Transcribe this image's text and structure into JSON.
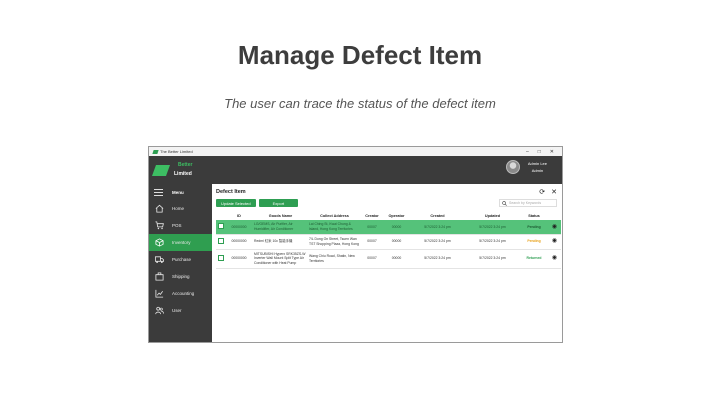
{
  "slide": {
    "title": "Manage Defect Item",
    "subtitle": "The user can trace the status of the defect item"
  },
  "window": {
    "title": "The Better Limited",
    "controls": [
      "–",
      "□",
      "✕"
    ]
  },
  "brand": {
    "line1": "Better",
    "line2": "Limited"
  },
  "user": {
    "name": "Admin Lee",
    "role": "Admin"
  },
  "sidebar": {
    "menu_label": "Menu",
    "items": [
      {
        "label": "Home",
        "icon": "home-icon",
        "active": false
      },
      {
        "label": "POS",
        "icon": "cart-icon",
        "active": false
      },
      {
        "label": "Inventory",
        "icon": "box-icon",
        "active": true
      },
      {
        "label": "Purchase",
        "icon": "truck-icon",
        "active": false
      },
      {
        "label": "Shipping",
        "icon": "shipping-icon",
        "active": false
      },
      {
        "label": "Accounting",
        "icon": "chart-icon",
        "active": false
      },
      {
        "label": "User",
        "icon": "users-icon",
        "active": false
      }
    ]
  },
  "main": {
    "title": "Defect Item",
    "update_button": "Update Selected",
    "export_button": "Export",
    "search_placeholder": "Search by Keywords",
    "columns": [
      "",
      "ID",
      "Goods Name",
      "Collect Address",
      "Creator",
      "Operator",
      "Created",
      "Updated",
      "Status",
      ""
    ],
    "rows": [
      {
        "id": "00000000",
        "goods": "LG/GEMS, Air Purifier, Air Humidifier, Air Conditioner",
        "address": "Lai Ching St, Kwai Chung & Island, Hong Kong Territories",
        "creator": "00007",
        "operator": "00000",
        "created": "5/7/2022 3:24 pm",
        "updated": "5/7/2022 3:24 pm",
        "status": "Pending"
      },
      {
        "id": "00000000",
        "goods": "Redmi 紅米 10c 智能手機",
        "address": "7/L Dong On Street, Tsuen Wan TST Shopping Plaza, Hong Kong",
        "creator": "00007",
        "operator": "00000",
        "created": "5/7/2022 3:24 pm",
        "updated": "5/7/2022 3:24 pm",
        "status": "Pending"
      },
      {
        "id": "00000000",
        "goods": "MITSUBISHI Hyperx SRK35ZS-W Inverter Wall Mount Split Type Air Conditioner with Heat Pump",
        "address": "Wang Chiu Road, Shatin, New Territories",
        "creator": "00007",
        "operator": "00000",
        "created": "5/7/2022 3:24 pm",
        "updated": "5/7/2022 3:24 pm",
        "status": "Returned"
      }
    ]
  },
  "colors": {
    "accent": "#2e9e52",
    "sidebar": "#3b3b3b",
    "pending": "#e8a21c"
  }
}
